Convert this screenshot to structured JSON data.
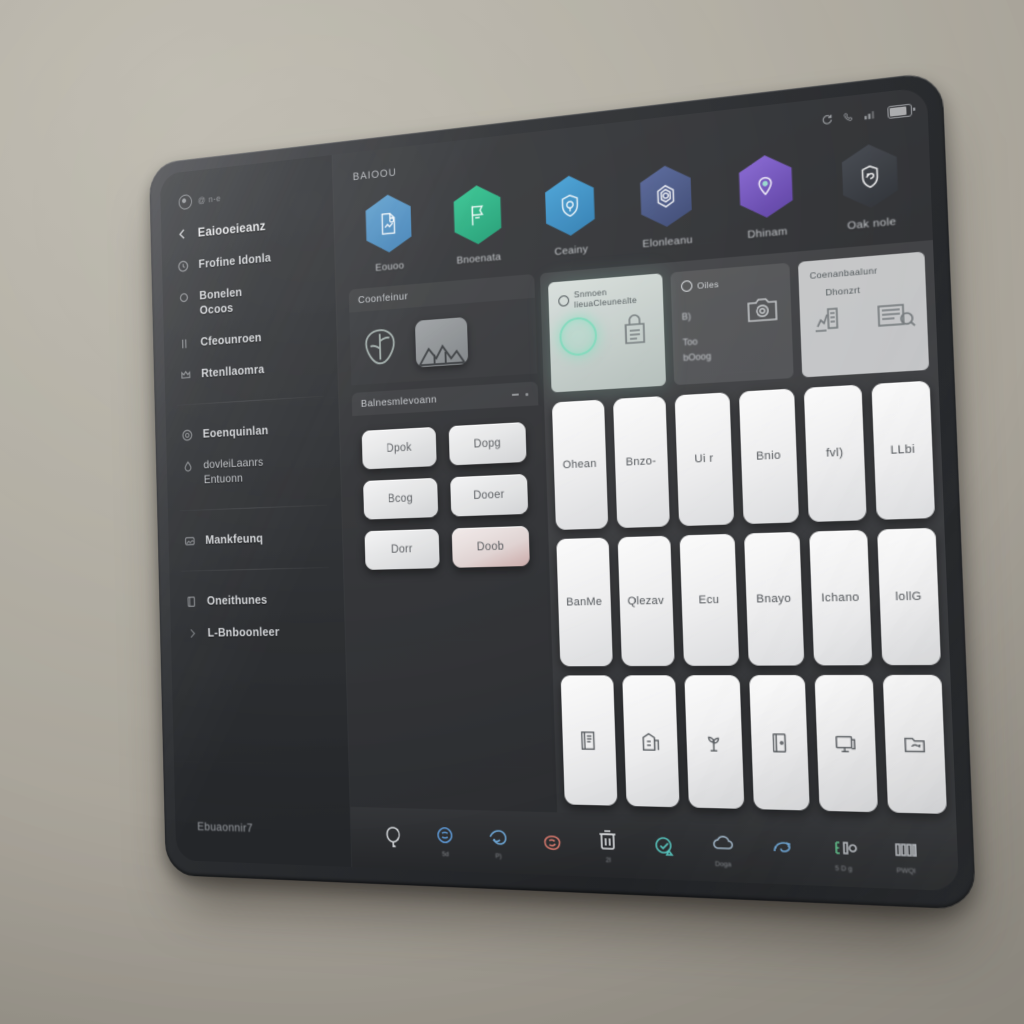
{
  "colors": {
    "wall": "#afaba0",
    "bezel": "#2a2c2f",
    "screen_bg": "#2b2d30",
    "sidebar_bg": "#2f3134",
    "accent_blue": "#4a8fc4",
    "accent_green": "#2bb183",
    "accent_cyan": "#3b93c9",
    "accent_indigo": "#5c6fa8",
    "accent_purple": "#7b5fc4",
    "accent_dark": "#3a3d44",
    "key_white": "#f2f2f3",
    "key_warn": "#caaaa8",
    "glow_green": "#7fd9bb"
  },
  "sidebar": {
    "brand": {
      "icon": "spiral-logo-icon",
      "text": "@ n-e"
    },
    "items": [
      {
        "label": "Eaiooeieanz",
        "icon": "chevron-left-icon",
        "style": "head"
      },
      {
        "label": "Frofine Idonla",
        "icon": "clock-icon",
        "style": "normal"
      },
      {
        "label": "Bonelen\nOcoos",
        "icon": "circle-icon",
        "style": "normal"
      },
      {
        "label": "Cfeounroen",
        "icon": "column-icon",
        "style": "normal"
      },
      {
        "label": "Rtenllaomra",
        "icon": "crown-icon",
        "style": "normal"
      },
      {
        "label": "Eoenquinlan",
        "icon": "at-icon",
        "style": "normal"
      },
      {
        "label": "dovleiLaanrs\nEntuonn",
        "icon": "drop-icon",
        "style": "sub"
      },
      {
        "label": "Mankfeunq",
        "icon": "image-icon",
        "style": "normal"
      },
      {
        "label": "Oneithunes",
        "icon": "book-icon",
        "style": "normal"
      },
      {
        "label": "L-Bnboonleer",
        "icon": "chevron-right-icon",
        "style": "normal"
      }
    ],
    "footer": "Ebuaonnir7"
  },
  "statusbar": {
    "icons": [
      "refresh-icon",
      "phone-icon",
      "signal-icon",
      "battery-icon"
    ],
    "battery_level": "72%"
  },
  "main": {
    "title": "BAIOOU",
    "apps": [
      {
        "label": "Eouoo",
        "icon": "document-share-icon",
        "color": "#4a8fc4"
      },
      {
        "label": "Bnoenata",
        "icon": "flag-icon",
        "color": "#2bb183"
      },
      {
        "label": "Ceainy",
        "icon": "shield-lock-icon",
        "color": "#3b93c9"
      },
      {
        "label": "Elonleanu",
        "icon": "gem-icon",
        "color": "#4f5e91"
      },
      {
        "label": "Dhinam",
        "icon": "pin-drop-icon",
        "color": "#7b5fc4"
      },
      {
        "label": "Oak nole",
        "icon": "badge-icon",
        "color": "#3a3d44"
      }
    ]
  },
  "left_panel": {
    "header": "Coonfeinur",
    "glyphs": [
      "leaf-glyph-icon",
      "mountain-thumb-icon"
    ],
    "second_header": "Balnesmlevoann",
    "keys": [
      {
        "label": "Dpok",
        "tone": "normal"
      },
      {
        "label": "Dopg",
        "tone": "normal"
      },
      {
        "label": "Bcog",
        "tone": "normal"
      },
      {
        "label": "Dooer",
        "tone": "normal"
      },
      {
        "label": "Dorr",
        "tone": "normal"
      },
      {
        "label": "Doob",
        "tone": "warn"
      }
    ]
  },
  "cards": [
    {
      "kind": "glow",
      "title": "Snmoen lieuaCleunealte",
      "icon": "circle-outline-icon",
      "illustration": "bag-illustration-icon"
    },
    {
      "kind": "mid",
      "title": "Oiles",
      "icon": "gear-icon",
      "lines": [
        "B)",
        "Too",
        "bOoog"
      ],
      "illustration": "camera-illustration-icon"
    },
    {
      "kind": "pale",
      "title": "Coenanbaalunr",
      "subtitle": "Dhonzrt",
      "illustration": "chart-printer-icon"
    }
  ],
  "grid": {
    "rows": [
      [
        {
          "label": "Ohean"
        },
        {
          "label": "Bnzo-"
        },
        {
          "label": "Ui r"
        },
        {
          "label": "Bnio"
        },
        {
          "label": "fvl)"
        },
        {
          "label": "LLbi"
        }
      ],
      [
        {
          "label": "BanMe"
        },
        {
          "label": "Qlezav"
        },
        {
          "label": "Ecu"
        },
        {
          "label": "Bnayo"
        },
        {
          "label": "Ichano"
        },
        {
          "label": "lollG"
        }
      ],
      [
        {
          "icon": "book-stack-icon"
        },
        {
          "icon": "building-icon"
        },
        {
          "icon": "plant-icon"
        },
        {
          "icon": "door-icon"
        },
        {
          "icon": "monitor-icon"
        },
        {
          "icon": "folder-hand-icon"
        }
      ]
    ]
  },
  "dock": {
    "items": [
      {
        "icon": "balloon-icon",
        "color": "#d9dcdf",
        "label": ""
      },
      {
        "icon": "knot-icon",
        "color": "#5f9ad6",
        "label": "5d"
      },
      {
        "icon": "wave-icon",
        "color": "#6fa8d8",
        "label": "P)"
      },
      {
        "icon": "coral-icon",
        "color": "#d97a6e",
        "label": ""
      },
      {
        "icon": "trash-icon",
        "color": "#e1e4e6",
        "label": "2l"
      },
      {
        "icon": "teal-badge-icon",
        "color": "#58c7c0",
        "label": ""
      },
      {
        "icon": "cloud-icon",
        "color": "#9fb3c4",
        "label": "Doga"
      },
      {
        "icon": "swirl-icon",
        "color": "#6fa8d8",
        "label": ""
      },
      {
        "icon": "code-icon",
        "color": "#5fbf8a",
        "label": "5 D g"
      },
      {
        "icon": "brackets-icon",
        "color": "#b9bdc2",
        "label": "PWQl"
      }
    ]
  }
}
